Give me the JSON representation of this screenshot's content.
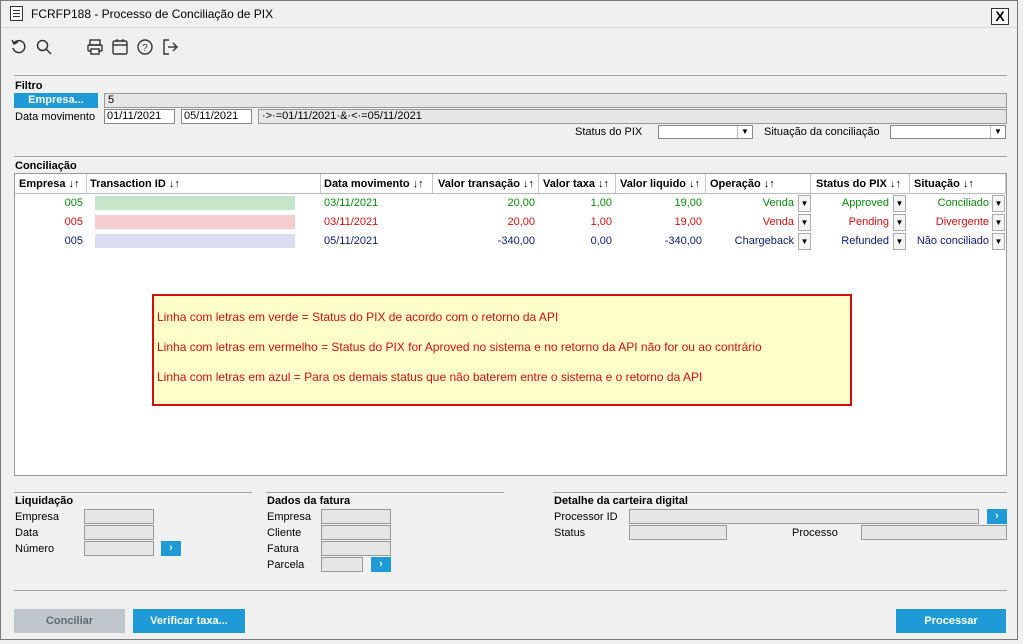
{
  "window": {
    "title": "FCRFP188 - Processo de Conciliação de PIX",
    "close_label": "X"
  },
  "toolbar": {
    "icons": [
      "undo-icon",
      "search-icon",
      "print-icon",
      "calendar-icon",
      "help-icon",
      "exit-icon"
    ]
  },
  "filter": {
    "section_label": "Filtro",
    "empresa_button": "Empresa...",
    "empresa_value": "5",
    "data_movimento_label": "Data movimento",
    "date_from": "01/11/2021",
    "date_to": "05/11/2021",
    "date_expression": "·>·=01/11/2021·&·<·=05/11/2021",
    "status_pix_label": "Status do PIX",
    "status_pix_value": "",
    "situacao_label": "Situação da conciliação",
    "situacao_value": ""
  },
  "conciliacao": {
    "section_label": "Conciliação",
    "columns": [
      "Empresa ↓↑",
      "Transaction ID ↓↑",
      "Data movimento ↓↑",
      "Valor transação ↓↑",
      "Valor taxa ↓↑",
      "Valor liquido ↓↑",
      "Operação ↓↑",
      "Status do PIX ↓↑",
      "Situação ↓↑"
    ],
    "rows": [
      {
        "empresa": "005",
        "transaction_id": "",
        "data": "03/11/2021",
        "valor": "20,00",
        "taxa": "1,00",
        "liquido": "19,00",
        "operacao": "Venda",
        "status": "Approved",
        "situacao": "Conciliado",
        "color": "#0a8a0a",
        "blur": "#bfe3c5"
      },
      {
        "empresa": "005",
        "transaction_id": "",
        "data": "03/11/2021",
        "valor": "20,00",
        "taxa": "1,00",
        "liquido": "19,00",
        "operacao": "Venda",
        "status": "Pending",
        "situacao": "Divergente",
        "color": "#d01010",
        "blur": "#f4c8c8"
      },
      {
        "empresa": "005",
        "transaction_id": "",
        "data": "05/11/2021",
        "valor": "-340,00",
        "taxa": "0,00",
        "liquido": "-340,00",
        "operacao": "Chargeback",
        "status": "Refunded",
        "situacao": "Não conciliado",
        "color": "#0a1a7a",
        "blur": "#d8d8ee"
      }
    ]
  },
  "legend_note": {
    "line1": "Linha com letras em verde = Status do PIX de acordo com o retorno da API",
    "line2": "Linha com letras em vermelho = Status do PIX for Aproved no sistema e no retorno da API não for ou ao contrário",
    "line3": "Linha com letras em azul = Para os demais status que não baterem entre o sistema e o retorno da API"
  },
  "liquidacao": {
    "section_label": "Liquidação",
    "empresa_label": "Empresa",
    "data_label": "Data",
    "numero_label": "Número",
    "go": "›"
  },
  "fatura": {
    "section_label": "Dados da fatura",
    "empresa_label": "Empresa",
    "cliente_label": "Cliente",
    "fatura_label": "Fatura",
    "parcela_label": "Parcela",
    "go": "›"
  },
  "carteira": {
    "section_label": "Detalhe da carteira digital",
    "processor_label": "Processor ID",
    "status_label": "Status",
    "processo_label": "Processo",
    "go": "›"
  },
  "footer": {
    "conciliar": "Conciliar",
    "verificar": "Verificar taxa...",
    "processar": "Processar"
  },
  "colors": {
    "accent": "#1e9bd7",
    "green": "#0a8a0a",
    "red": "#d01010",
    "blue": "#0a1a7a"
  }
}
